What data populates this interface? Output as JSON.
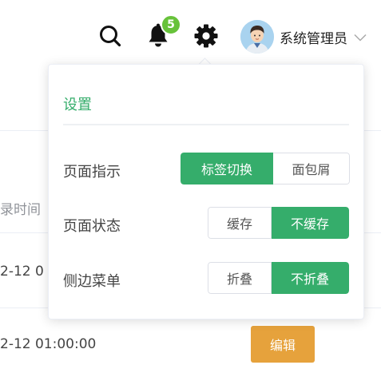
{
  "header": {
    "search_icon": "search-icon",
    "bell_icon": "bell-icon",
    "notification_count": "5",
    "settings_icon": "gear-icon",
    "user": {
      "name": "系统管理员",
      "avatar_icon": "avatar-icon",
      "caret_icon": "chevron-down-icon"
    }
  },
  "table": {
    "column_header": "录时间",
    "rows": [
      {
        "time": "2-12 0"
      },
      {
        "time": "2-12 01:00:00",
        "action": "编辑"
      }
    ]
  },
  "settings": {
    "title": "设置",
    "rows": [
      {
        "label": "页面指示",
        "options": [
          "标签切换",
          "面包屑"
        ],
        "selected": "标签切换"
      },
      {
        "label": "页面状态",
        "options": [
          "缓存",
          "不缓存"
        ],
        "selected": "不缓存"
      },
      {
        "label": "侧边菜单",
        "options": [
          "折叠",
          "不折叠"
        ],
        "selected": "不折叠"
      }
    ]
  },
  "colors": {
    "accent": "#35ad6b",
    "badge": "#67c23a",
    "warning": "#e6a23c"
  }
}
